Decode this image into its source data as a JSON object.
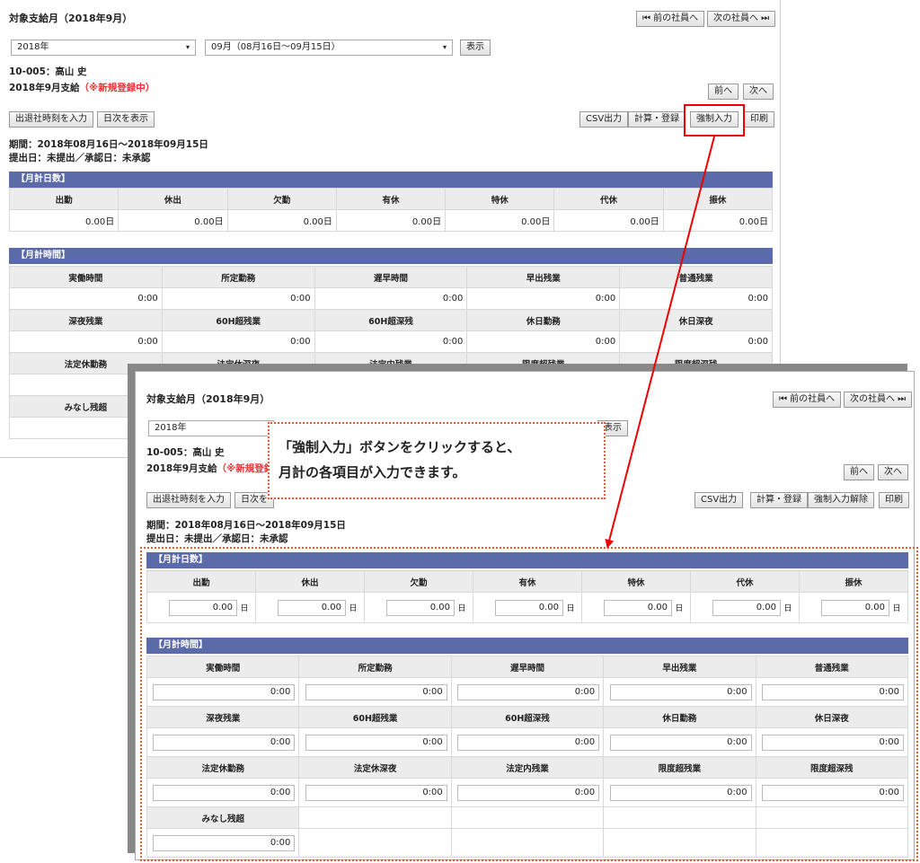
{
  "top": {
    "title": "対象支給月（2018年9月）",
    "prev_emp": "⏮ 前の社員へ",
    "next_emp": "次の社員へ ⏭",
    "year_select": "2018年",
    "period_select": "09月（08月16日〜09月15日）",
    "show_btn": "表示",
    "emp_id": "10-005：高山 史",
    "pay_label": "2018年9月支給",
    "status_label": "（※新規登録中）",
    "prev_btn": "前へ",
    "next_btn": "次へ",
    "attend_btn": "出退社時刻を入力",
    "daily_btn": "日次を表示",
    "csv_btn": "CSV出力",
    "calc_btn": "計算・登録",
    "force_btn": "強制入力",
    "print_btn": "印刷",
    "period_text": "期間：2018年08月16日〜2018年09月15日",
    "submit_text": "提出日：未提出／承認日：未承認",
    "days_band": "【月計日数】",
    "days_headers": [
      "出勤",
      "休出",
      "欠勤",
      "有休",
      "特休",
      "代休",
      "振休"
    ],
    "days_values": [
      "0.00日",
      "0.00日",
      "0.00日",
      "0.00日",
      "0.00日",
      "0.00日",
      "0.00日"
    ],
    "time_band": "【月計時間】",
    "time_row1_headers": [
      "実働時間",
      "所定勤務",
      "遅早時間",
      "早出残業",
      "普通残業"
    ],
    "time_row1_values": [
      "0:00",
      "0:00",
      "0:00",
      "0:00",
      "0:00"
    ],
    "time_row2_headers": [
      "深夜残業",
      "60H超残業",
      "60H超深残",
      "休日勤務",
      "休日深夜"
    ],
    "time_row2_values": [
      "0:00",
      "0:00",
      "0:00",
      "0:00",
      "0:00"
    ],
    "time_row3_headers": [
      "法定休勤務",
      "法定休深夜",
      "法定内残業",
      "限度超残業",
      "限度超深残"
    ],
    "time_row4_header": "みなし残超"
  },
  "bottom": {
    "title": "対象支給月（2018年9月）",
    "prev_emp": "⏮ 前の社員へ",
    "next_emp": "次の社員へ ⏭",
    "year_select": "2018年",
    "show_btn": "表示",
    "emp_id": "10-005：高山 史",
    "pay_label": "2018年9月支給",
    "status_label": "（※新規登録",
    "prev_btn": "前へ",
    "next_btn": "次へ",
    "attend_btn": "出退社時刻を入力",
    "daily_btn": "日次を",
    "csv_btn": "CSV出力",
    "calc_btn": "計算・登録",
    "force_release_btn": "強制入力解除",
    "print_btn": "印刷",
    "period_text": "期間：2018年08月16日〜2018年09月15日",
    "submit_text": "提出日：未提出／承認日：未承認",
    "days_band": "【月計日数】",
    "days_headers": [
      "出勤",
      "休出",
      "欠勤",
      "有休",
      "特休",
      "代休",
      "振休"
    ],
    "days_values": [
      "0.00",
      "0.00",
      "0.00",
      "0.00",
      "0.00",
      "0.00",
      "0.00"
    ],
    "day_unit": "日",
    "time_band": "【月計時間】",
    "time_row1_headers": [
      "実働時間",
      "所定勤務",
      "遅早時間",
      "早出残業",
      "普通残業"
    ],
    "time_row1_values": [
      "0:00",
      "0:00",
      "0:00",
      "0:00",
      "0:00"
    ],
    "time_row2_headers": [
      "深夜残業",
      "60H超残業",
      "60H超深残",
      "休日勤務",
      "休日深夜"
    ],
    "time_row2_values": [
      "0:00",
      "0:00",
      "0:00",
      "0:00",
      "0:00"
    ],
    "time_row3_headers": [
      "法定休勤務",
      "法定休深夜",
      "法定内残業",
      "限度超残業",
      "限度超深残"
    ],
    "time_row3_values": [
      "0:00",
      "0:00",
      "0:00",
      "0:00",
      "0:00"
    ],
    "time_row4_header": "みなし残超",
    "time_row4_value": "0:00"
  },
  "callout": {
    "line1": "「強制入力」ボタンをクリックすると、",
    "line2": "月計の各項目が入力できます。"
  },
  "colors": {
    "band": "#5b6aa8",
    "highlight": "#e00000",
    "dotted": "#e53322"
  }
}
